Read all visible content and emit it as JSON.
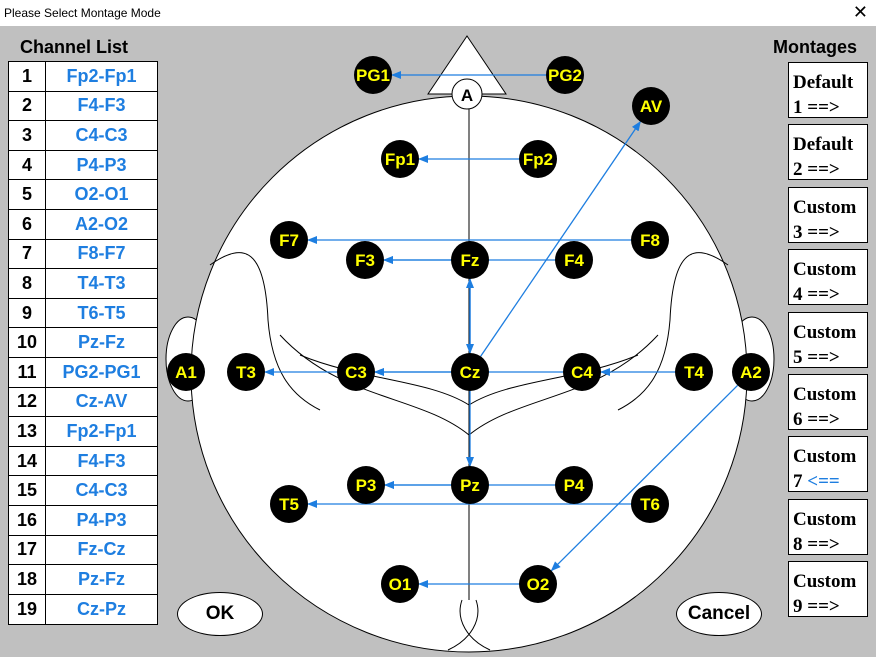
{
  "window": {
    "title": "Please Select Montage Mode",
    "close": "✕"
  },
  "channel_list": {
    "heading": "Channel List",
    "rows": [
      {
        "num": "1",
        "name": "Fp2-Fp1"
      },
      {
        "num": "2",
        "name": "F4-F3"
      },
      {
        "num": "3",
        "name": "C4-C3"
      },
      {
        "num": "4",
        "name": "P4-P3"
      },
      {
        "num": "5",
        "name": "O2-O1"
      },
      {
        "num": "6",
        "name": "A2-O2"
      },
      {
        "num": "7",
        "name": "F8-F7"
      },
      {
        "num": "8",
        "name": "T4-T3"
      },
      {
        "num": "9",
        "name": "T6-T5"
      },
      {
        "num": "10",
        "name": "Pz-Fz"
      },
      {
        "num": "11",
        "name": "PG2-PG1"
      },
      {
        "num": "12",
        "name": "Cz-AV"
      },
      {
        "num": "13",
        "name": "Fp2-Fp1"
      },
      {
        "num": "14",
        "name": "F4-F3"
      },
      {
        "num": "15",
        "name": "C4-C3"
      },
      {
        "num": "16",
        "name": "P4-P3"
      },
      {
        "num": "17",
        "name": "Fz-Cz"
      },
      {
        "num": "18",
        "name": "Pz-Fz"
      },
      {
        "num": "19",
        "name": "Cz-Pz"
      }
    ]
  },
  "montages": {
    "heading": "Montages",
    "items": [
      {
        "line1": "Default",
        "line2": "1 ==>",
        "sel": ""
      },
      {
        "line1": "Default",
        "line2": "2 ==>",
        "sel": ""
      },
      {
        "line1": "Custom",
        "line2": "3 ==>",
        "sel": ""
      },
      {
        "line1": "Custom",
        "line2": "4 ==>",
        "sel": ""
      },
      {
        "line1": "Custom",
        "line2": "5 ==>",
        "sel": ""
      },
      {
        "line1": "Custom",
        "line2": "6 ==>",
        "sel": ""
      },
      {
        "line1": "Custom",
        "line2": "7 ",
        "sel": "<=="
      },
      {
        "line1": "Custom",
        "line2": "8 ==>",
        "sel": ""
      },
      {
        "line1": "Custom",
        "line2": "9 ==>",
        "sel": ""
      }
    ]
  },
  "head_map": {
    "nose_label": "A",
    "electrodes": [
      "PG1",
      "PG2",
      "AV",
      "Fp1",
      "Fp2",
      "F7",
      "F8",
      "F3",
      "Fz",
      "F4",
      "A1",
      "T3",
      "C3",
      "Cz",
      "C4",
      "T4",
      "A2",
      "P3",
      "Pz",
      "P4",
      "T5",
      "T6",
      "O1",
      "O2"
    ]
  },
  "buttons": {
    "ok": "OK",
    "cancel": "Cancel"
  },
  "colors": {
    "arrow": "#1e7ee0",
    "electrode_fill": "#000000",
    "electrode_text": "#ffff00",
    "channel_text": "#1e7ee0"
  }
}
